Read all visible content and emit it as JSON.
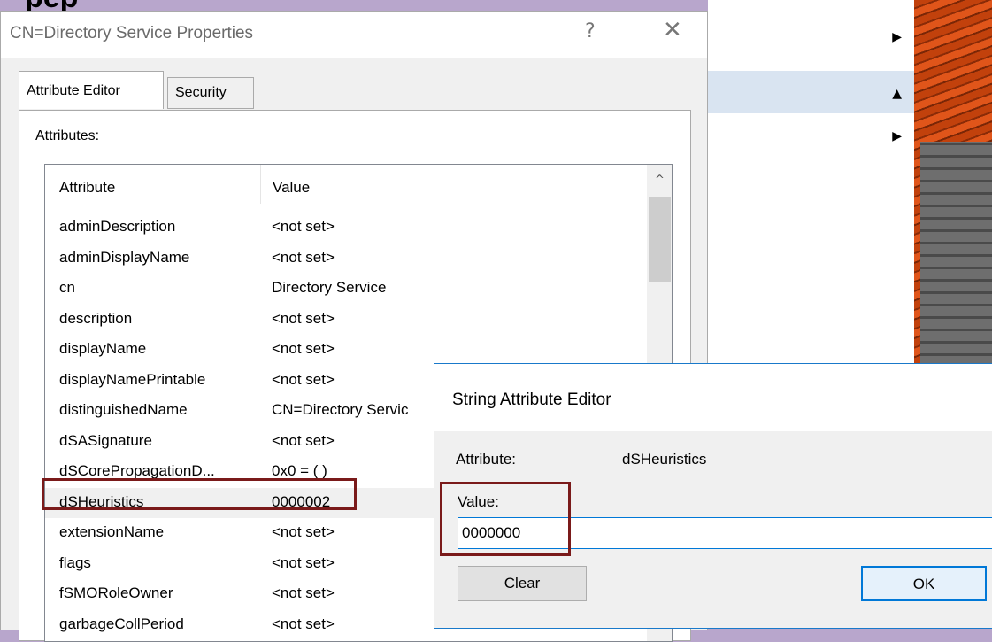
{
  "background": {
    "heading_fragment": "pep",
    "menu_arrows": [
      "▶",
      "▲",
      "▶"
    ]
  },
  "properties_dialog": {
    "title": "CN=Directory Service Properties",
    "help_label": "?",
    "close_label": "✕",
    "tabs": [
      {
        "label": "Attribute Editor"
      },
      {
        "label": "Security"
      }
    ],
    "attributes_label": "Attributes:",
    "columns": {
      "attribute": "Attribute",
      "value": "Value"
    },
    "rows": [
      {
        "attribute": "adminDescription",
        "value": "<not set>"
      },
      {
        "attribute": "adminDisplayName",
        "value": "<not set>"
      },
      {
        "attribute": "cn",
        "value": "Directory Service"
      },
      {
        "attribute": "description",
        "value": "<not set>"
      },
      {
        "attribute": "displayName",
        "value": "<not set>"
      },
      {
        "attribute": "displayNamePrintable",
        "value": "<not set>"
      },
      {
        "attribute": "distinguishedName",
        "value": "CN=Directory Servic"
      },
      {
        "attribute": "dSASignature",
        "value": "<not set>"
      },
      {
        "attribute": "dSCorePropagationD...",
        "value": "0x0 = ( )"
      },
      {
        "attribute": "dSHeuristics",
        "value": "0000002"
      },
      {
        "attribute": "extensionName",
        "value": "<not set>"
      },
      {
        "attribute": "flags",
        "value": "<not set>"
      },
      {
        "attribute": "fSMORoleOwner",
        "value": "<not set>"
      },
      {
        "attribute": "garbageCollPeriod",
        "value": "<not set>"
      }
    ],
    "scroll_up_label": "^"
  },
  "string_editor": {
    "title": "String Attribute Editor",
    "attribute_label": "Attribute:",
    "attribute_value": "dSHeuristics",
    "value_label": "Value:",
    "value_input": "0000000",
    "clear_label": "Clear",
    "ok_label": "OK"
  },
  "colors": {
    "accent": "#0078d7",
    "highlight_box": "#7a1a1a",
    "desktop": "#b8a6cc"
  }
}
